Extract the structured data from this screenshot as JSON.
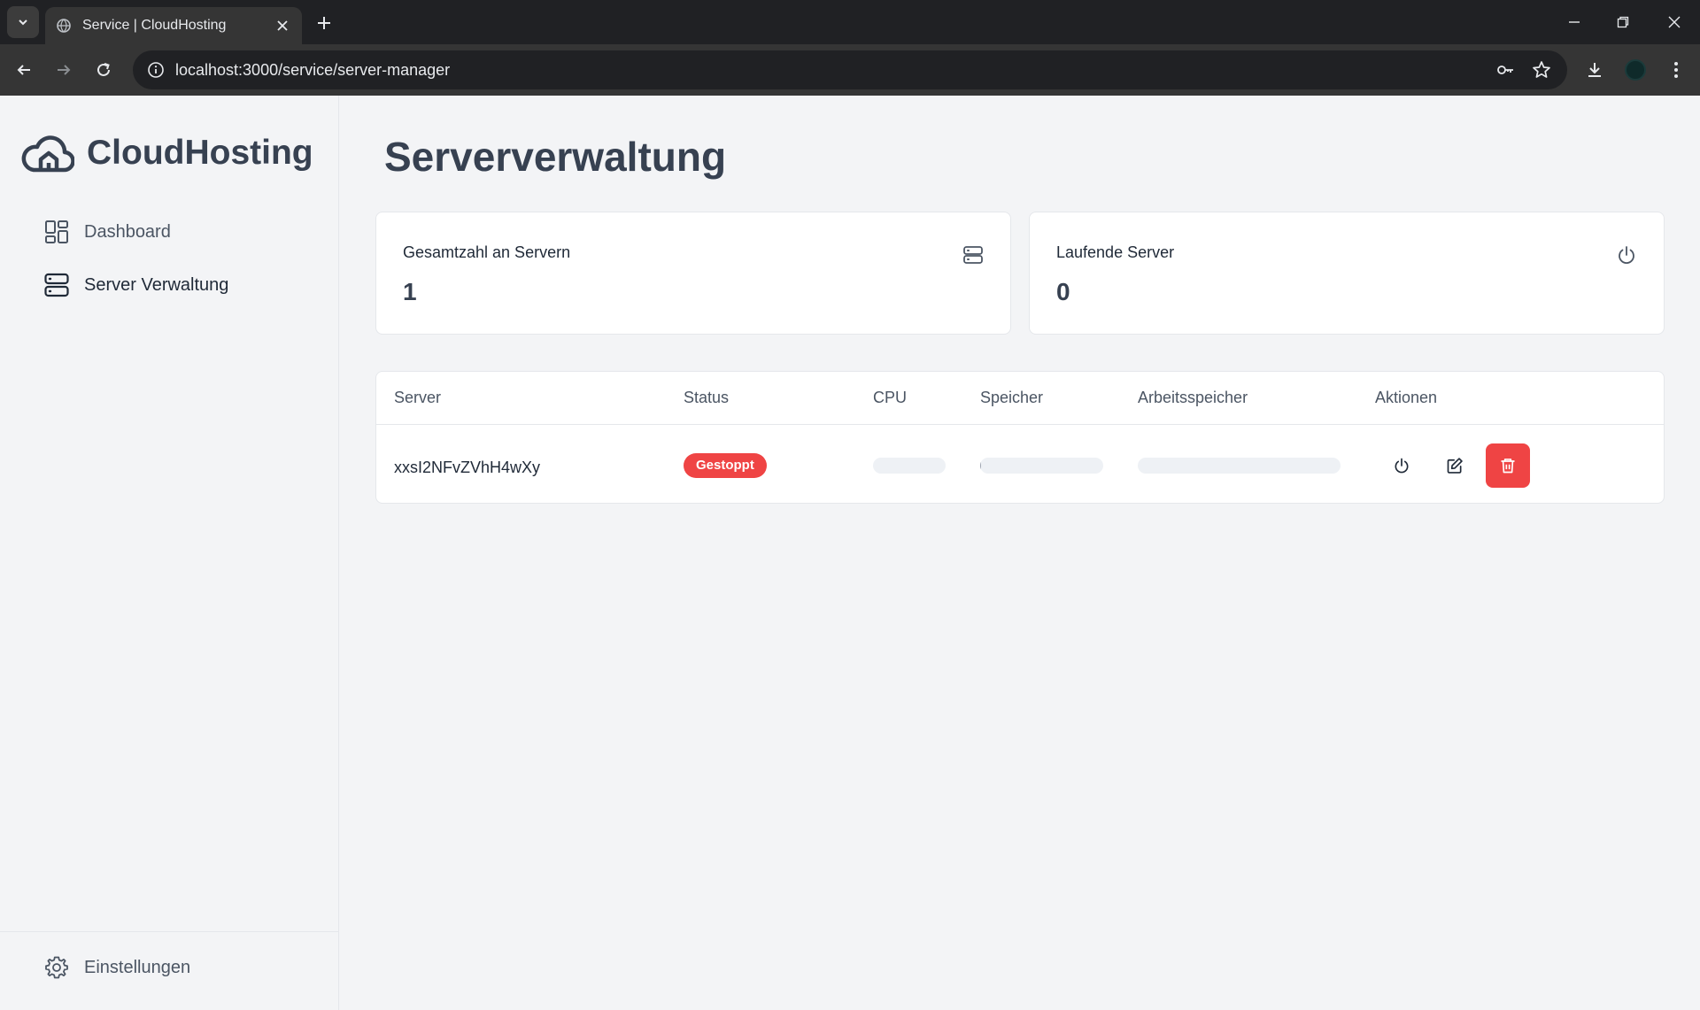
{
  "browser": {
    "tab_title": "Service | CloudHosting",
    "url": "localhost:3000/service/server-manager"
  },
  "app": {
    "brand": "CloudHosting",
    "nav": [
      {
        "label": "Dashboard",
        "icon": "dashboard-grid-icon",
        "active": false
      },
      {
        "label": "Server Verwaltung",
        "icon": "server-icon",
        "active": true
      }
    ],
    "settings_label": "Einstellungen"
  },
  "page": {
    "title": "Serververwaltung",
    "stats": [
      {
        "label": "Gesamtzahl an Servern",
        "value": "1",
        "icon": "server-icon"
      },
      {
        "label": "Laufende Server",
        "value": "0",
        "icon": "power-icon"
      }
    ],
    "table": {
      "headers": [
        "Server",
        "Status",
        "CPU",
        "Speicher",
        "Arbeitsspeicher",
        "Aktionen"
      ],
      "rows": [
        {
          "server": "xxsI2NFvZVhH4wXy",
          "status": "Gestoppt",
          "cpu_usage": 0,
          "storage_usage": 0.01,
          "memory_usage": 0,
          "actions": [
            "power-icon",
            "edit-icon",
            "trash-icon"
          ]
        }
      ]
    }
  },
  "colors": {
    "danger": "#ef4444",
    "text_primary": "#374151",
    "background": "#f3f4f6"
  }
}
